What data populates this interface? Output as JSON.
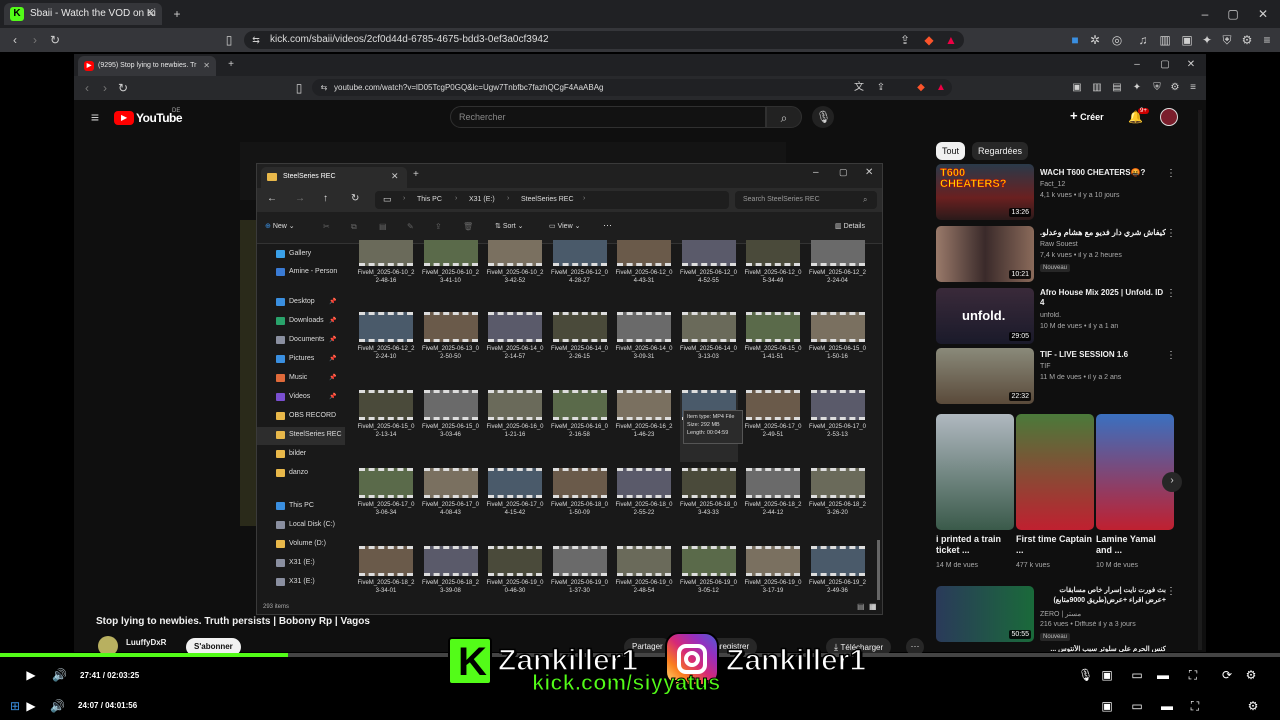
{
  "outer_browser": {
    "tab_title": "Sbaii - Watch the VOD on Ki",
    "url": "kick.com/sbaii/videos/2cf0d44d-6785-4675-bdd3-0ef3a0cf3942"
  },
  "inner_browser": {
    "tab_title": "(9295) Stop lying to newbies. Tr",
    "url": "youtube.com/watch?v=lD05TcgP0GQ&lc=Ugw7Tnbfbc7fazhQCgF4AaABAg"
  },
  "youtube": {
    "logo": "YouTube",
    "logo_region": "DE",
    "search_placeholder": "Rechercher",
    "create_label": "Créer",
    "notif_count": "9+",
    "video_title": "Stop lying to newbies. Truth persists | Bobony Rp | Vagos",
    "channel_name": "LuuffyDxR",
    "subscribe_label": "S'abonner",
    "actions": [
      "Partager",
      "Enregistrer",
      "Télécharger"
    ],
    "chips": [
      "Tout",
      "Regardées"
    ],
    "suggestions": [
      {
        "title": "WACH T600 CHEATERS🤬?",
        "channel": "Fact_12",
        "meta": "4,1 k vues • il y a 10 jours",
        "duration": "13:26",
        "thumb_text": "T600 CHEATERS?"
      },
      {
        "title": "كيفاش شري دار فديو مع هشام وعدلو..؟",
        "channel": "Raw Souest",
        "meta": "7,4 k vues • il y a 2 heures",
        "badge": "Nouveau",
        "duration": "10:21"
      },
      {
        "title": "Afro House Mix 2025 | Unfold. ID 4",
        "channel": "unfold.",
        "meta": "10 M de vues • il y a 1 an",
        "duration": "29:05",
        "thumb_text": "unfold."
      },
      {
        "title": "TIF - LIVE SESSION 1.6",
        "channel": "TIF",
        "meta": "11 M de vues • il y a 2 ans",
        "duration": "22:32"
      }
    ],
    "shorts": [
      {
        "title": "i printed a train ticket ...",
        "meta": "14 M de vues"
      },
      {
        "title": "First time Captain ...",
        "meta": "477 k vues"
      },
      {
        "title": "Lamine Yamal and ...",
        "meta": "10 M de vues"
      }
    ],
    "suggestion_last": {
      "title": "بث فورت نايت إسرار خاص مسابقات +عرض اقراء +عرض(طريق 9000متابع)",
      "channel": "ZERO | مستر",
      "meta": "216 vues • Diffusé il y a 3 jours",
      "badge": "Nouveau",
      "duration": "50:55"
    },
    "suggestion_cut": "كنس الحرم على سلوتر سبب الأنتوس ..."
  },
  "explorer": {
    "window_title": "SteelSeries REC",
    "breadcrumb": [
      "This PC",
      "X31 (E:)",
      "SteelSeries REC"
    ],
    "search_placeholder": "Search SteelSeries REC",
    "toolbar": {
      "new": "New",
      "sort": "Sort",
      "view": "View",
      "details": "Details"
    },
    "nav": [
      {
        "label": "Gallery",
        "color": "#3aa0e8"
      },
      {
        "label": "Amine - Person",
        "color": "#3a7bd5"
      },
      {
        "label": "Desktop",
        "color": "#3a8fe0",
        "pin": true
      },
      {
        "label": "Downloads",
        "color": "#29a36b",
        "pin": true
      },
      {
        "label": "Documents",
        "color": "#8a8fa0",
        "pin": true
      },
      {
        "label": "Pictures",
        "color": "#3a8fe0",
        "pin": true
      },
      {
        "label": "Music",
        "color": "#e06a3a",
        "pin": true
      },
      {
        "label": "Videos",
        "color": "#7a4fd0",
        "pin": true
      },
      {
        "label": "OBS RECORD",
        "color": "#e8b84a"
      },
      {
        "label": "SteelSeries REC",
        "color": "#e8b84a"
      },
      {
        "label": "bilder",
        "color": "#e8b84a"
      },
      {
        "label": "danzo",
        "color": "#e8b84a"
      },
      {
        "label": "This PC",
        "color": "#3a8fe0"
      },
      {
        "label": "Local Disk (C:)",
        "color": "#8a8fa0"
      },
      {
        "label": "Volume (D:)",
        "color": "#e8b84a"
      },
      {
        "label": "X31 (E:)",
        "color": "#8a8fa0"
      },
      {
        "label": "X31 (E:)",
        "color": "#8a8fa0"
      }
    ],
    "status": "293 items",
    "tooltip": {
      "type": "Item type: MP4 File",
      "size": "Size: 292 MB",
      "length": "Length: 00:04:59"
    },
    "files": [
      [
        "FiveM_2025-06-10_22-48-16",
        "FiveM_2025-06-10_23-41-10",
        "FiveM_2025-06-10_23-42-52",
        "FiveM_2025-06-12_04-28-27",
        "FiveM_2025-06-12_04-43-31",
        "FiveM_2025-06-12_04-52-55",
        "FiveM_2025-06-12_05-34-49",
        "FiveM_2025-06-12_22-24-04"
      ],
      [
        "FiveM_2025-06-12_22-24-10",
        "FiveM_2025-06-13_02-50-50",
        "FiveM_2025-06-14_02-14-57",
        "FiveM_2025-06-14_02-26-15",
        "FiveM_2025-06-14_03-09-31",
        "FiveM_2025-06-14_03-13-03",
        "FiveM_2025-06-15_01-41-51",
        "FiveM_2025-06-15_01-50-16"
      ],
      [
        "FiveM_2025-06-15_02-13-14",
        "FiveM_2025-06-15_03-03-46",
        "FiveM_2025-06-16_01-21-16",
        "FiveM_2025-06-16_02-16-58",
        "FiveM_2025-06-16_21-46-23",
        "",
        "FiveM_2025-06-17_02-49-51",
        "FiveM_2025-06-17_02-53-13"
      ],
      [
        "FiveM_2025-06-17_03-06-34",
        "FiveM_2025-06-17_04-08-43",
        "FiveM_2025-06-17_04-15-42",
        "FiveM_2025-06-18_01-50-09",
        "FiveM_2025-06-18_02-55-22",
        "FiveM_2025-06-18_03-43-33",
        "FiveM_2025-06-18_22-44-12",
        "FiveM_2025-06-18_23-26-20"
      ],
      [
        "FiveM_2025-06-18_23-34-01",
        "FiveM_2025-06-18_23-39-08",
        "FiveM_2025-06-19_00-46-30",
        "FiveM_2025-06-19_01-37-30",
        "FiveM_2025-06-19_02-48-54",
        "FiveM_2025-06-19_03-05-12",
        "FiveM_2025-06-19_03-17-19",
        "FiveM_2025-06-19_22-49-36"
      ]
    ]
  },
  "player": {
    "time_current": "27:41",
    "time_total": "02:03:25",
    "progress": 0.225
  },
  "outer_player": {
    "time_current": "24:07",
    "time_total": "04:01:56"
  },
  "overlay": {
    "kick_handle": "Zankiller1",
    "instagram_handle": "Zankiller1",
    "kick_url": "kick.com/siyyatus"
  },
  "colors": {
    "kick_green": "#53fc18",
    "yt_red": "#ff0000",
    "folder": "#e8b84a"
  }
}
